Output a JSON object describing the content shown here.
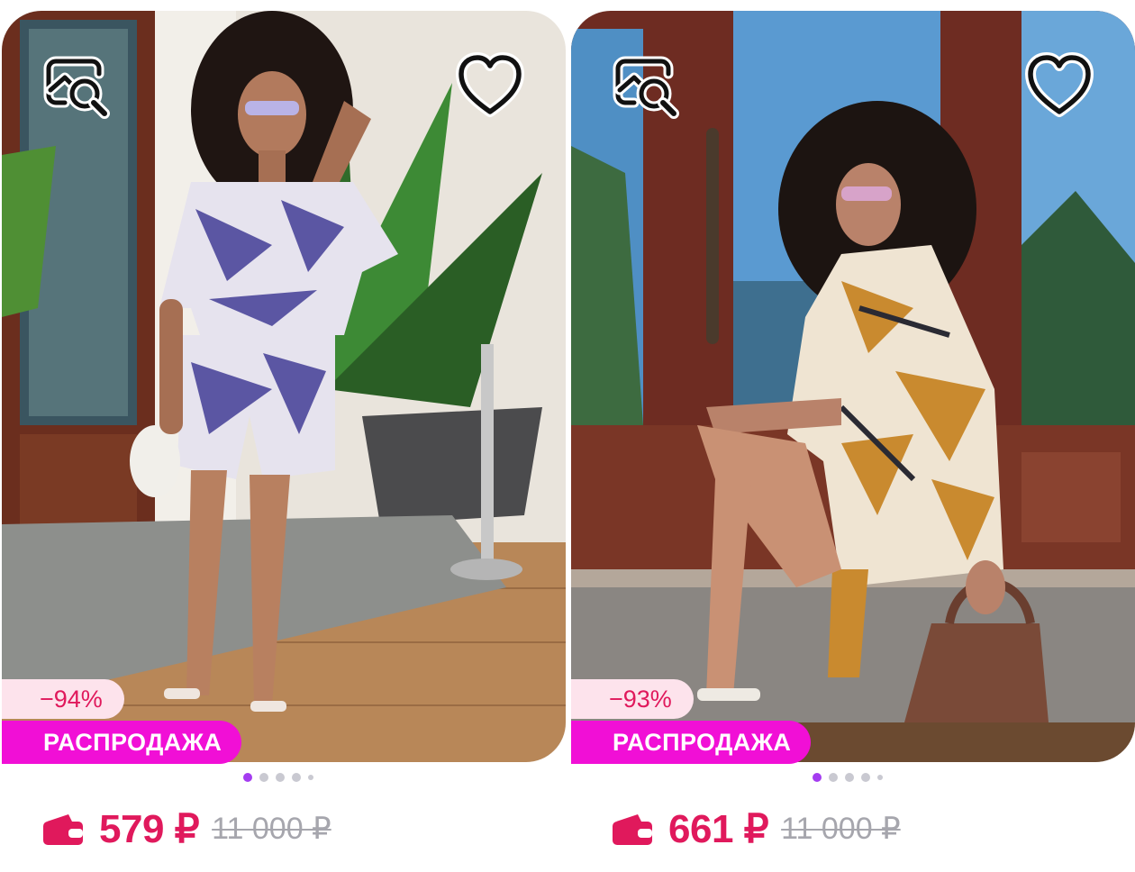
{
  "colors": {
    "price": "#e0195c",
    "old_price": "#a6a6ad",
    "sale_badge_bg": "#f10fd6",
    "discount_badge_bg": "#fde3ec",
    "active_dot": "#a43cf0",
    "inactive_dot": "#c9c9d1"
  },
  "icons": {
    "visual_search": "image-search-icon",
    "favorite": "heart-outline-icon",
    "wallet": "wallet-icon"
  },
  "products": [
    {
      "discount": "−94%",
      "sale_label": "РАСПРОДАЖА",
      "price": "579 ₽",
      "old_price": "11 000 ₽",
      "carousel": {
        "active_index": 0,
        "total": 5
      },
      "outfit_color": "#5b56a3"
    },
    {
      "discount": "−93%",
      "sale_label": "РАСПРОДАЖА",
      "price": "661 ₽",
      "old_price": "11 000 ₽",
      "carousel": {
        "active_index": 0,
        "total": 5
      },
      "outfit_color": "#c98a2f"
    }
  ]
}
